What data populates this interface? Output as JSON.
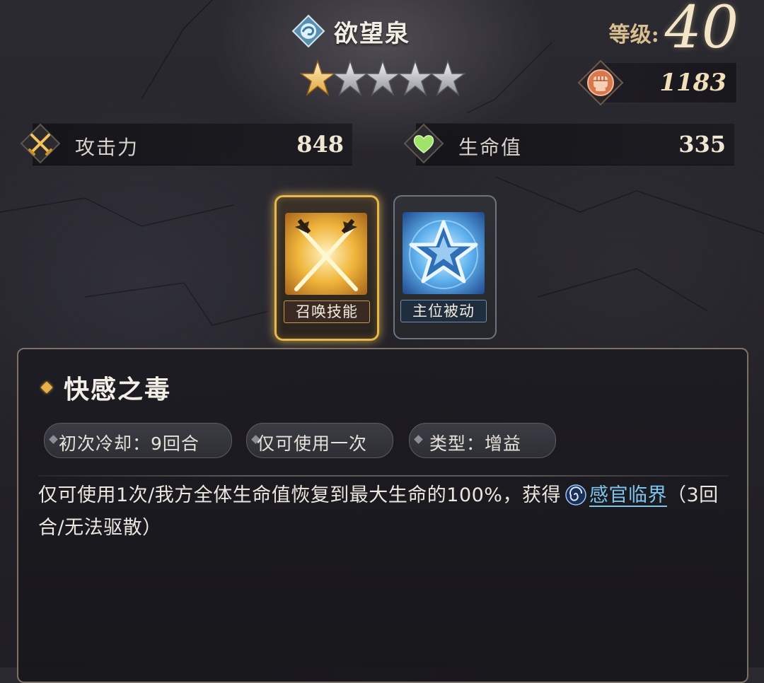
{
  "character": {
    "name": "欲望泉",
    "element_icon": "water-swirl-icon",
    "star_rating": 1,
    "max_stars": 5,
    "level_label": "等级:",
    "level": "40",
    "power_icon": "fist-icon",
    "power": "1183"
  },
  "stats": {
    "attack": {
      "icon": "crossed-swords-icon",
      "label": "攻击力",
      "value": "848"
    },
    "hp": {
      "icon": "heart-icon",
      "label": "生命值",
      "value": "335"
    }
  },
  "skills": [
    {
      "label": "召唤技能",
      "icon": "crossed-swords-icon",
      "selected": true
    },
    {
      "label": "主位被动",
      "icon": "star-icon",
      "selected": false
    }
  ],
  "skill_detail": {
    "title": "快感之毒",
    "tags": [
      "初次冷却：9回合",
      "仅可使用一次",
      "类型：增益"
    ],
    "description_prefix": "仅可使用1次/我方全体生命值恢复到最大生命的100%，获得",
    "buff_icon": "vortex-icon",
    "buff_name": "感官临界",
    "description_suffix": "（3回合/无法驱散）"
  },
  "colors": {
    "accent_gold": "#e9b84a",
    "link_blue": "#7fc4ef",
    "panel_border": "#7d7266"
  }
}
